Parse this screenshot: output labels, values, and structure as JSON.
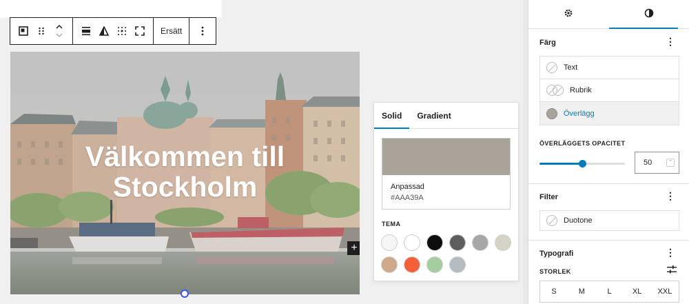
{
  "toolbar": {
    "replace_label": "Ersätt"
  },
  "cover": {
    "title_line1": "Välkommen till",
    "title_line2": "Stockholm",
    "overlay_color": "#AAA39A",
    "overlay_opacity_percent": 50
  },
  "color_popover": {
    "tabs": [
      "Solid",
      "Gradient"
    ],
    "active_tab": "Solid",
    "custom_label": "Anpassad",
    "custom_hex": "#AAA39A",
    "theme_label": "TEMA",
    "palette": [
      "#f5f5f5",
      "#ffffff",
      "#0d0d0d",
      "#5e5e5e",
      "#a7a7a7",
      "#d6d2c6",
      "#d0a98d",
      "#f4603a",
      "#a5cda0",
      "#b3bcbe"
    ]
  },
  "sidebar": {
    "tabs": [
      "settings-icon",
      "styles-icon"
    ],
    "color_panel": {
      "title": "Färg",
      "items": [
        {
          "label": "Text"
        },
        {
          "label": "Rubrik"
        },
        {
          "label": "Överlägg"
        }
      ],
      "opacity_label": "ÖVERLÄGGETS OPACITET",
      "opacity_value": "50"
    },
    "filter_panel": {
      "title": "Filter",
      "duotone_label": "Duotone"
    },
    "typography_panel": {
      "title": "Typografi",
      "size_label": "STORLEK",
      "sizes": [
        "S",
        "M",
        "L",
        "XL",
        "XXL"
      ]
    }
  }
}
